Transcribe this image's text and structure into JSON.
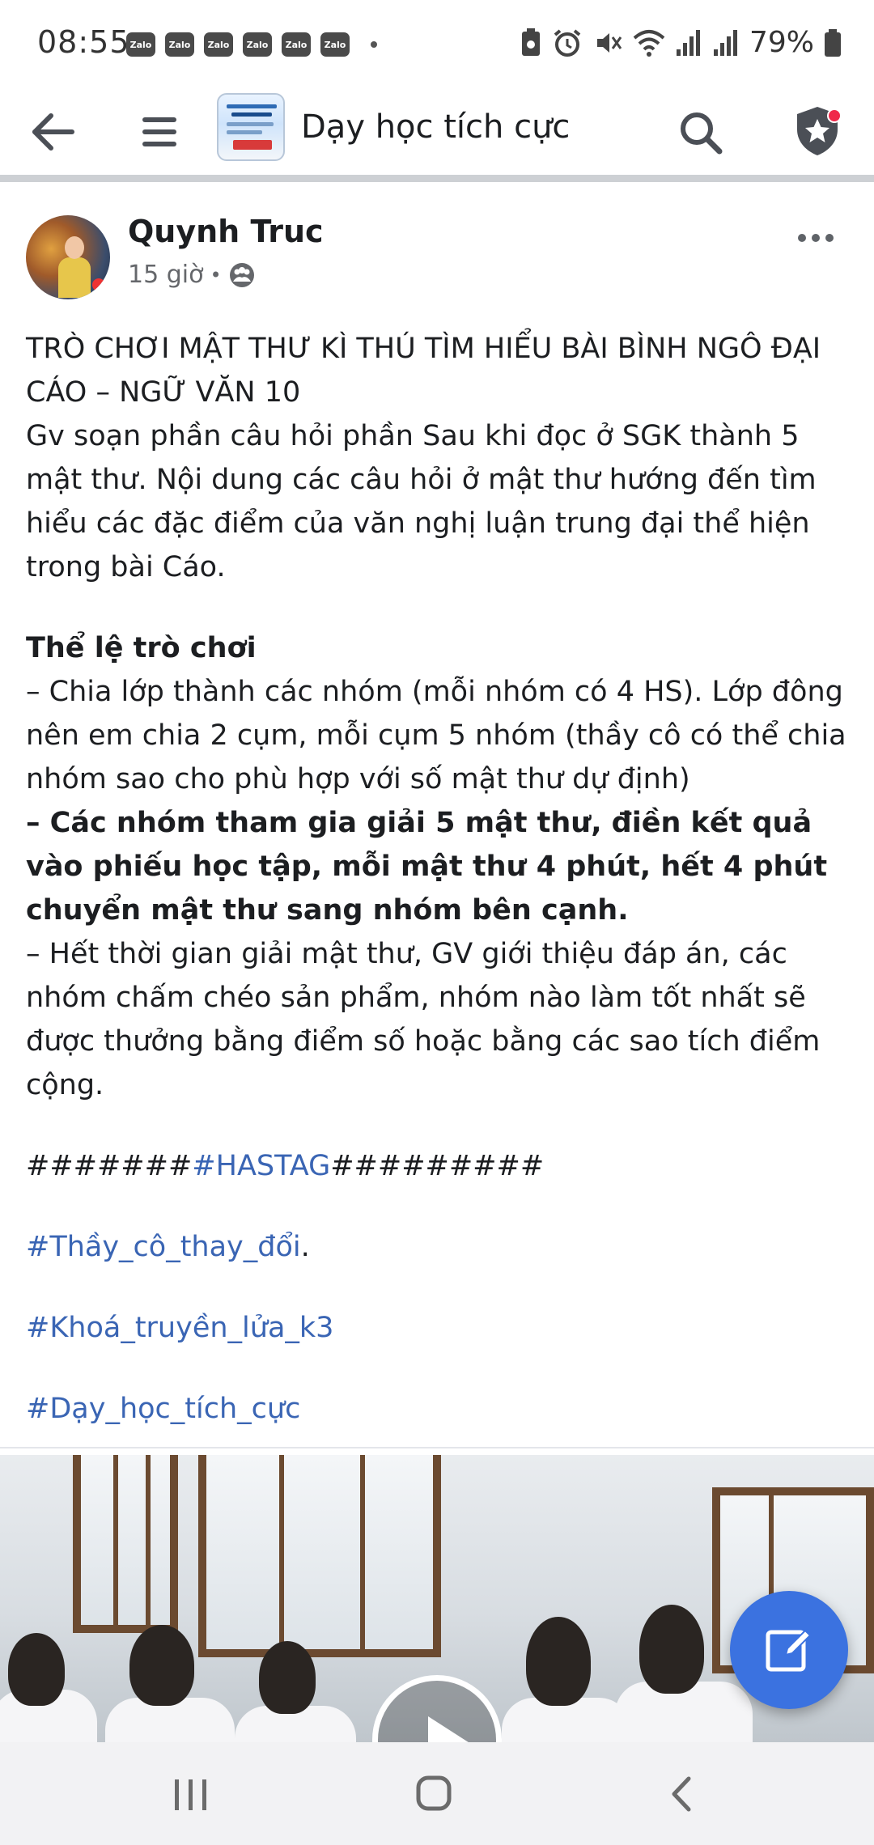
{
  "status_bar": {
    "time": "08:55",
    "notification_icons": [
      "Zalo",
      "Zalo",
      "Zalo",
      "Zalo",
      "Zalo",
      "Zalo"
    ],
    "battery_percent": "79%"
  },
  "app_bar": {
    "group_title": "Dạy học tích cực",
    "icons": {
      "back": "arrow-left-icon",
      "menu": "menu-icon",
      "search": "search-icon",
      "admin": "shield-star-icon"
    }
  },
  "post": {
    "author": "Quynh Truc",
    "time_ago": "15 giờ",
    "meta_separator": "•",
    "audience_icon": "group-audience-icon",
    "body": {
      "title_line": "TRÒ CHƠI MẬT THƯ KÌ THÚ TÌM HIỂU BÀI BÌNH NGÔ ĐẠI CÁO – NGỮ VĂN 10",
      "intro": "Gv soạn phần câu hỏi phần Sau khi đọc ở SGK thành 5 mật thư. Nội dung các câu hỏi ở mật thư hướng đến tìm hiểu các đặc điểm của văn nghị luận trung đại thể hiện trong bài Cáo.",
      "rules_heading": "Thể lệ trò chơi",
      "rule_1": "– Chia lớp thành các nhóm (mỗi nhóm có 4 HS). Lớp đông nên em chia 2 cụm, mỗi cụm 5 nhóm (thầy cô có thể chia nhóm sao cho phù hợp với số mật thư dự định)",
      "rule_2": "– Các nhóm tham gia giải 5 mật thư, điền kết quả vào phiếu học tập, mỗi mật thư 4 phút, hết 4 phút chuyển mật thư sang nhóm bên cạnh.",
      "rule_3": "– Hết thời gian giải mật thư, GV giới thiệu đáp án, các nhóm chấm chéo sản phẩm, nhóm nào làm tốt nhất sẽ được thưởng bằng điểm số hoặc bằng các sao tích điểm cộng.",
      "hashtag_prefix": "#######",
      "hashtag_main": "#HASTAG",
      "hashtag_suffix": "#########",
      "tag_1": "#Thầy_cô_thay_đổi",
      "tag_1_suffix": ".",
      "tag_2": "#Khoá_truyền_lửa_k3",
      "tag_3": "#Dạy_học_tích_cực"
    },
    "media": {
      "type": "video",
      "play_icon": "play-icon"
    }
  },
  "fab": {
    "icon": "compose-icon"
  },
  "nav_bar": {
    "icons": [
      "recents-icon",
      "home-icon",
      "back-icon"
    ]
  },
  "colors": {
    "link": "#3a65b4",
    "fab": "#3b72e0",
    "notification_dot": "#f02849",
    "divider": "#cdd0d4"
  }
}
